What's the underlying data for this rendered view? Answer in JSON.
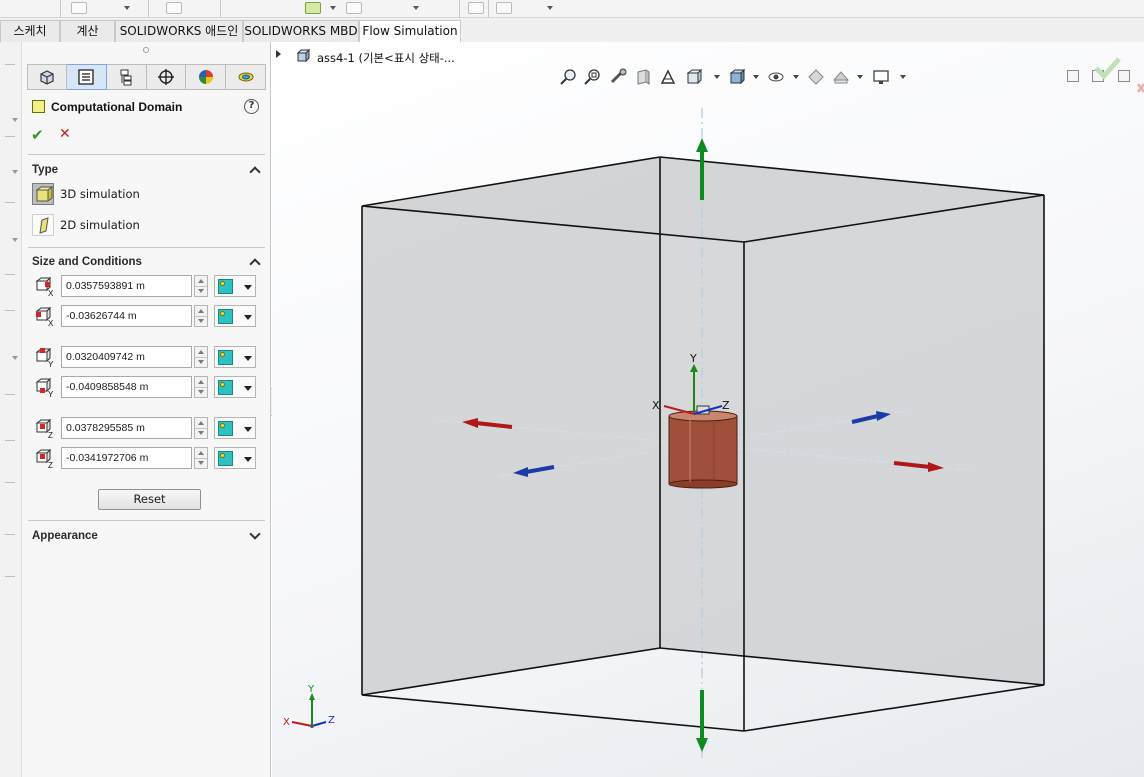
{
  "tabs": [
    {
      "label": "스케치"
    },
    {
      "label": "계산"
    },
    {
      "label": "SOLIDWORKS 애드인"
    },
    {
      "label": "SOLIDWORKS MBD"
    },
    {
      "label": "Flow Simulation"
    }
  ],
  "active_tab": "Flow Simulation",
  "property_manager": {
    "title": "Computational Domain",
    "help_label": "?",
    "ok_icon": "check-icon",
    "cancel_icon": "x-icon",
    "pm_tabs": [
      "feature-manager-icon",
      "property-manager-icon",
      "configuration-manager-icon",
      "dimxpert-icon",
      "display-manager-icon",
      "flow-simulation-icon"
    ],
    "type": {
      "title": "Type",
      "options": [
        {
          "label": "3D simulation",
          "selected": true
        },
        {
          "label": "2D simulation",
          "selected": false
        }
      ]
    },
    "size": {
      "title": "Size and Conditions",
      "fields": [
        {
          "axis": "X",
          "bound": "max",
          "value": "0.0357593891 m"
        },
        {
          "axis": "X",
          "bound": "min",
          "value": "-0.03626744 m"
        },
        {
          "axis": "Y",
          "bound": "max",
          "value": "0.0320409742 m"
        },
        {
          "axis": "Y",
          "bound": "min",
          "value": "-0.0409858548 m"
        },
        {
          "axis": "Z",
          "bound": "max",
          "value": "0.0378295585 m"
        },
        {
          "axis": "Z",
          "bound": "min",
          "value": "-0.0341972706 m"
        }
      ],
      "reset_label": "Reset"
    },
    "appearance": {
      "title": "Appearance"
    }
  },
  "tree": {
    "label": "ass4-1  (기본<표시 상태-..."
  },
  "triad_main": {
    "x": "X",
    "y": "Y",
    "z": "Z"
  },
  "triad_corner": {
    "x": "X",
    "y": "Y",
    "z": "Z"
  },
  "colors": {
    "green_handle": "#0f8a1e",
    "red_handle": "#b01818",
    "blue_handle": "#1c3aa8",
    "cylinder": "#a0503a",
    "panel_bg": "#f7f7f7",
    "active_pm_tab": "#d7e6f6"
  }
}
